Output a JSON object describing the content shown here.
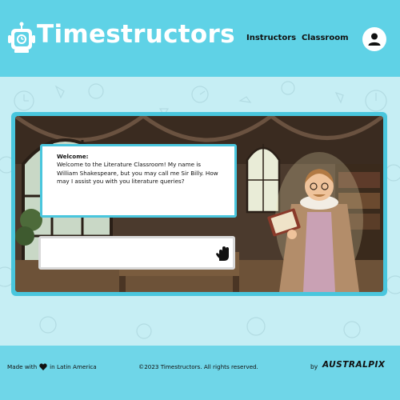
{
  "header": {
    "brand": "Timestructors",
    "nav": [
      {
        "label": "Instructors"
      },
      {
        "label": "Classroom"
      }
    ]
  },
  "chat": {
    "title": "Welcome:",
    "message": "Welcome to the Literature Classroom! My name is William Shakespeare, but you may call me Sir Billy. How may I assist you with you literature queries?",
    "input_value": ""
  },
  "footer": {
    "made_prefix": "Made with",
    "made_suffix": "in Latin America",
    "copyright": "©2023 Timestructors. All rights reserved.",
    "by": "by",
    "partner": "AUSTRALPIX"
  },
  "colors": {
    "header_bg": "#5fd2e6",
    "accent": "#49c6dd",
    "pattern_bg": "#c6eef4"
  }
}
